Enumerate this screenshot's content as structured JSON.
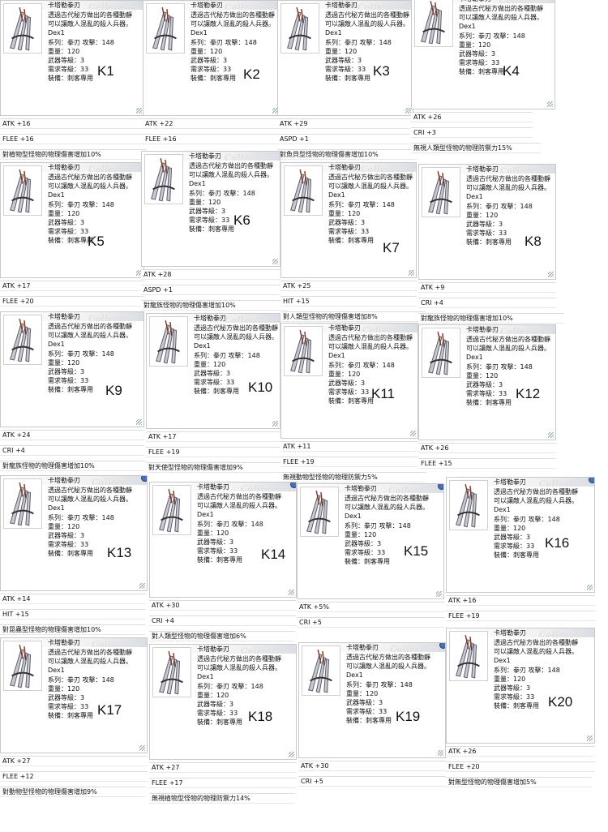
{
  "item": {
    "name": "卡塔勒拳刃",
    "desc1": "透過古代秘方做出的各種動靜",
    "desc2": "可以讓敵人混亂的殺人兵器。",
    "dex": "Dex1",
    "type_line": "系列：拳刃 攻擊：148",
    "weight_line": "重量：120",
    "level_line": "武器等級：3",
    "req_line": "需求等級：33",
    "equip_line": "裝備：刺客專用",
    "watermark": "Collection",
    "icon": "katar-icon"
  },
  "cards": [
    {
      "label": "K1",
      "stats": [
        "ATK +16",
        "FLEE +16",
        "對植物型怪物的物理傷害增加10%"
      ]
    },
    {
      "label": "K2",
      "stats": [
        "ATK +22",
        "FLEE +16"
      ]
    },
    {
      "label": "K3",
      "stats": [
        "ATK +29",
        "ASPD +1",
        "對魚貝型怪物的物理傷害增加10%"
      ]
    },
    {
      "label": "K4",
      "stats": [
        "ATK +26",
        "CRI +3",
        "無視人類型怪物的物理防禦力15%"
      ]
    },
    {
      "label": "K5",
      "stats": [
        "ATK +17",
        "FLEE +20"
      ]
    },
    {
      "label": "K6",
      "stats": [
        "ATK +28",
        "ASPD +1",
        "對龍族怪物的物理傷害增加10%"
      ]
    },
    {
      "label": "K7",
      "stats": [
        "ATK +25",
        "HIT +15",
        "對人類型怪物的物理傷害增加8%"
      ]
    },
    {
      "label": "K8",
      "stats": [
        "ATK +9",
        "CRI +4",
        "對龍族怪物的物理傷害增加10%"
      ]
    },
    {
      "label": "K9",
      "stats": [
        "ATK +24",
        "CRI +4",
        "對龍族怪物的物理傷害增加10%"
      ]
    },
    {
      "label": "K10",
      "stats": [
        "ATK +17",
        "FLEE +19",
        "對天使型怪物的物理傷害增加9%"
      ]
    },
    {
      "label": "K11",
      "stats": [
        "ATK +11",
        "FLEE +19",
        "無視動物型怪物的物理防禦力5%"
      ]
    },
    {
      "label": "K12",
      "stats": [
        "ATK +26",
        "FLEE +15"
      ]
    },
    {
      "label": "K13",
      "stats": [
        "ATK +14",
        "HIT +15",
        "對昆蟲型怪物的物理傷害增加10%"
      ]
    },
    {
      "label": "K14",
      "stats": [
        "ATK +30",
        "CRI +4",
        "對人類型怪物的物理傷害增加6%"
      ]
    },
    {
      "label": "K15",
      "stats": [
        "ATK +5%",
        "CRI +5"
      ]
    },
    {
      "label": "K16",
      "stats": [
        "ATK +16",
        "FLEE +19"
      ]
    },
    {
      "label": "K17",
      "stats": [
        "ATK +27",
        "FLEE +12",
        "對動物型怪物的物理傷害增加9%"
      ]
    },
    {
      "label": "K18",
      "stats": [
        "ATK +27",
        "FLEE +17",
        "無視植物型怪物的物理防禦力14%"
      ]
    },
    {
      "label": "K19",
      "stats": [
        "ATK +30",
        "CRI +5"
      ]
    },
    {
      "label": "K20",
      "stats": [
        "ATK +26",
        "FLEE +20",
        "對無型怪物的物理傷害增加5%"
      ]
    }
  ]
}
